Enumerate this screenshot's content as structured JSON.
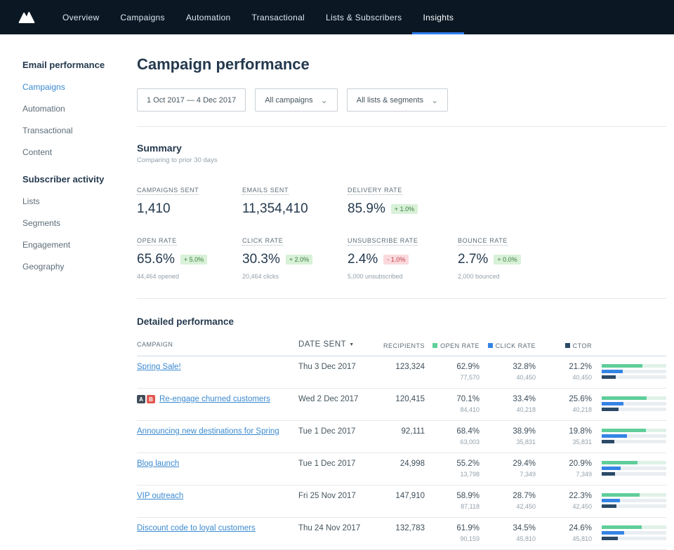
{
  "icons": {
    "chevron_down": "⌄",
    "sort_desc": "▼"
  },
  "colors": {
    "accent_blue": "#2d7ef0",
    "link_blue": "#3b8ad0",
    "open_green": "#5fce9a",
    "click_blue": "#3584e4",
    "ctor_navy": "#2b4a68",
    "positive_bg": "#d8f1d8",
    "negative_bg": "#f9d9dc"
  },
  "nav": {
    "items": [
      {
        "label": "Overview",
        "name": "nav-item-overview"
      },
      {
        "label": "Campaigns",
        "name": "nav-item-campaigns"
      },
      {
        "label": "Automation",
        "name": "nav-item-automation"
      },
      {
        "label": "Transactional",
        "name": "nav-item-transactional"
      },
      {
        "label": "Lists & Subscribers",
        "name": "nav-item-lists-subscribers"
      },
      {
        "label": "Insights",
        "name": "nav-item-insights",
        "active": true
      }
    ]
  },
  "sidebar": {
    "performance": {
      "heading": "Email performance",
      "items": [
        {
          "label": "Campaigns",
          "name": "sidebar-item-campaigns",
          "active": true
        },
        {
          "label": "Automation",
          "name": "sidebar-item-automation"
        },
        {
          "label": "Transactional",
          "name": "sidebar-item-transactional"
        },
        {
          "label": "Content",
          "name": "sidebar-item-content"
        }
      ]
    },
    "activity": {
      "heading": "Subscriber activity",
      "items": [
        {
          "label": "Lists",
          "name": "sidebar-item-lists"
        },
        {
          "label": "Segments",
          "name": "sidebar-item-segments"
        },
        {
          "label": "Engagement",
          "name": "sidebar-item-engagement"
        },
        {
          "label": "Geography",
          "name": "sidebar-item-geography"
        }
      ]
    }
  },
  "page": {
    "title": "Campaign performance",
    "filters": {
      "date_range": "1 Oct 2017  —  4 Dec 2017",
      "campaigns": "All campaigns",
      "lists_segments": "All lists & segments"
    }
  },
  "summary": {
    "heading": "Summary",
    "subheading": "Comparing to prior 30 days",
    "metrics_row1": [
      {
        "label": "CAMPAIGNS SENT",
        "value": "1,410"
      },
      {
        "label": "EMAILS SENT",
        "value": "11,354,410"
      },
      {
        "label": "DELIVERY RATE",
        "value": "85.9%",
        "delta": "+ 1.0%",
        "delta_type": "positive"
      }
    ],
    "metrics_row2": [
      {
        "label": "OPEN RATE",
        "value": "65.6%",
        "delta": "+ 5.0%",
        "delta_type": "positive",
        "sub": "44,464 opened"
      },
      {
        "label": "CLICK RATE",
        "value": "30.3%",
        "delta": "+ 2.0%",
        "delta_type": "positive",
        "sub": "20,464 clicks"
      },
      {
        "label": "UNSUBSCRIBE RATE",
        "value": "2.4%",
        "delta": "- 1.0%",
        "delta_type": "negative",
        "sub": "5,000 unsubscribed"
      },
      {
        "label": "BOUNCE RATE",
        "value": "2.7%",
        "delta": "+ 0.0%",
        "delta_type": "positive",
        "sub": "2,000 bounced"
      }
    ]
  },
  "table": {
    "heading": "Detailed performance",
    "columns": {
      "campaign": "CAMPAIGN",
      "date_sent": "DATE SENT",
      "recipients": "RECIPIENTS",
      "open_rate": "OPEN RATE",
      "click_rate": "CLICK RATE",
      "ctor": "CTOR"
    },
    "rows": [
      {
        "campaign": "Spring Sale!",
        "date": "Thu 3 Dec 2017",
        "recipients": "123,324",
        "open_rate": "62.9%",
        "open_count": "77,570",
        "click_rate": "32.8%",
        "click_count": "40,450",
        "ctor": "21.2%",
        "ctor_count": "40,450",
        "open_pct": 62.9,
        "click_pct": 32.8,
        "ctor_pct": 21.2
      },
      {
        "campaign": "Re-engage churned customers",
        "ab_test": [
          "A",
          "B"
        ],
        "date": "Wed 2 Dec 2017",
        "recipients": "120,415",
        "open_rate": "70.1%",
        "open_count": "84,410",
        "click_rate": "33.4%",
        "click_count": "40,218",
        "ctor": "25.6%",
        "ctor_count": "40,218",
        "open_pct": 70.1,
        "click_pct": 33.4,
        "ctor_pct": 25.6
      },
      {
        "campaign": "Announcing new destinations for Spring",
        "date": "Tue 1 Dec 2017",
        "recipients": "92,111",
        "open_rate": "68.4%",
        "open_count": "63,003",
        "click_rate": "38.9%",
        "click_count": "35,831",
        "ctor": "19.8%",
        "ctor_count": "35,831",
        "open_pct": 68.4,
        "click_pct": 38.9,
        "ctor_pct": 19.8
      },
      {
        "campaign": "Blog launch",
        "date": "Tue 1 Dec 2017",
        "recipients": "24,998",
        "open_rate": "55.2%",
        "open_count": "13,798",
        "click_rate": "29.4%",
        "click_count": "7,349",
        "ctor": "20.9%",
        "ctor_count": "7,349",
        "open_pct": 55.2,
        "click_pct": 29.4,
        "ctor_pct": 20.9
      },
      {
        "campaign": "VIP outreach",
        "date": "Fri 25 Nov 2017",
        "recipients": "147,910",
        "open_rate": "58.9%",
        "open_count": "87,118",
        "click_rate": "28.7%",
        "click_count": "42,450",
        "ctor": "22.3%",
        "ctor_count": "42,450",
        "open_pct": 58.9,
        "click_pct": 28.7,
        "ctor_pct": 22.3
      },
      {
        "campaign": "Discount code to loyal customers",
        "date": "Thu 24 Nov 2017",
        "recipients": "132,783",
        "open_rate": "61.9%",
        "open_count": "90,159",
        "click_rate": "34.5%",
        "click_count": "45,810",
        "ctor": "24.6%",
        "ctor_count": "45,810",
        "open_pct": 61.9,
        "click_pct": 34.5,
        "ctor_pct": 24.6
      }
    ]
  }
}
